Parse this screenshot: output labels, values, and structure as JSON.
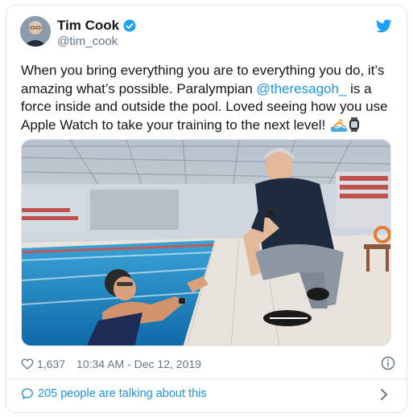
{
  "tweet": {
    "display_name": "Tim Cook",
    "handle": "@tim_cook",
    "text_part1": "When you bring everything you are to everything you do, it’s amazing what’s possible. Paralympian ",
    "mention": "@theresagoh_",
    "text_part2": " is a force inside and outside the pool. Loved seeing how you use Apple Watch to take your training to the next level!",
    "emojis": [
      "swimmer-emoji",
      "watch-emoji"
    ],
    "likes": "1,637",
    "timestamp": "10:34 AM - Dec 12, 2019",
    "conversation": "205 people are talking about this"
  },
  "colors": {
    "accent": "#1b95e0",
    "text": "#14171a",
    "secondary": "#657786",
    "border": "#e1e8ed"
  },
  "icons": [
    "verified-badge-icon",
    "twitter-bird-icon",
    "heart-icon",
    "info-icon",
    "speech-bubble-icon",
    "chevron-right-icon"
  ]
}
